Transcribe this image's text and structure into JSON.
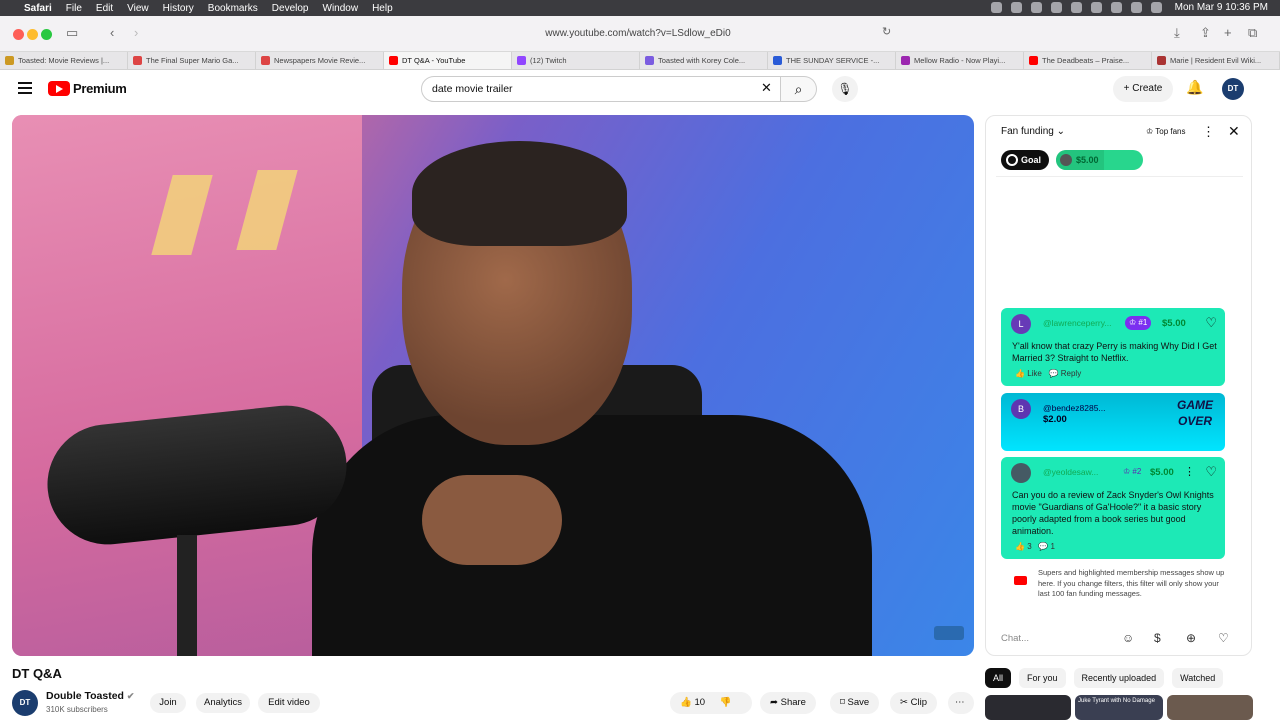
{
  "menubar": {
    "app": "Safari",
    "menus": [
      "File",
      "Edit",
      "View",
      "History",
      "Bookmarks",
      "Develop",
      "Window",
      "Help"
    ],
    "clock": "Mon Mar 9  10:36 PM"
  },
  "browser": {
    "url": "www.youtube.com/watch?v=LSdlow_eDi0",
    "tabs": [
      {
        "label": "Toasted: Movie Reviews |..."
      },
      {
        "label": "The Final Super Mario Ga..."
      },
      {
        "label": "Newspapers Movie Revie..."
      },
      {
        "label": "DT Q&A - YouTube",
        "active": true
      },
      {
        "label": "(12) Twitch"
      },
      {
        "label": "Toasted with Korey Cole..."
      },
      {
        "label": "THE SUNDAY SERVICE -..."
      },
      {
        "label": "Mellow Radio - Now Playi..."
      },
      {
        "label": "The Deadbeats – Praise..."
      },
      {
        "label": "Marie | Resident Evil Wiki..."
      }
    ]
  },
  "youtube": {
    "logo_text": "Premium",
    "search_value": "date movie trailer",
    "create_label": "Create",
    "avatar_text": "DT"
  },
  "video": {
    "title": "DT Q&A",
    "channel": "Double Toasted",
    "subscribers": "310K subscribers",
    "channel_avatar": "DT",
    "join_label": "Join",
    "analytics_label": "Analytics",
    "edit_label": "Edit video",
    "likes": "10",
    "share_label": "Share",
    "save_label": "Save",
    "clip_label": "Clip"
  },
  "fan_funding": {
    "title": "Fan funding",
    "top_fans": "Top fans",
    "goal_label": "Goal",
    "goal_amount": "$5.00",
    "goal_progress": 0.55,
    "cards": [
      {
        "avatar": "L",
        "user": "@lawrenceperry...",
        "badge": "#1",
        "amount": "$5.00",
        "message": "Y'all know that crazy Perry is making Why Did I Get Married 3? Straight to Netflix.",
        "like_label": "Like",
        "reply_label": "Reply"
      },
      {
        "avatar": "B",
        "user": "@bendez8285...",
        "amount": "$2.00",
        "sticker": "GAME OVER"
      },
      {
        "user": "@yeoldesaw...",
        "badge": "#2",
        "amount": "$5.00",
        "message": "Can you do a review of Zack Snyder's Owl Knights movie \"Guardians of Ga'Hoole?\" it a basic story poorly adapted from a book series but good animation.",
        "likes": "3",
        "replies": "1"
      }
    ],
    "notice": "Supers and highlighted membership messages show up here. If you change filters, this filter will only show your last 100 fan funding messages.",
    "chat_placeholder": "Chat..."
  },
  "filters": [
    "All",
    "For you",
    "Recently uploaded",
    "Watched"
  ],
  "thumbnail_caption": "Juke Tyrant with No Damage"
}
